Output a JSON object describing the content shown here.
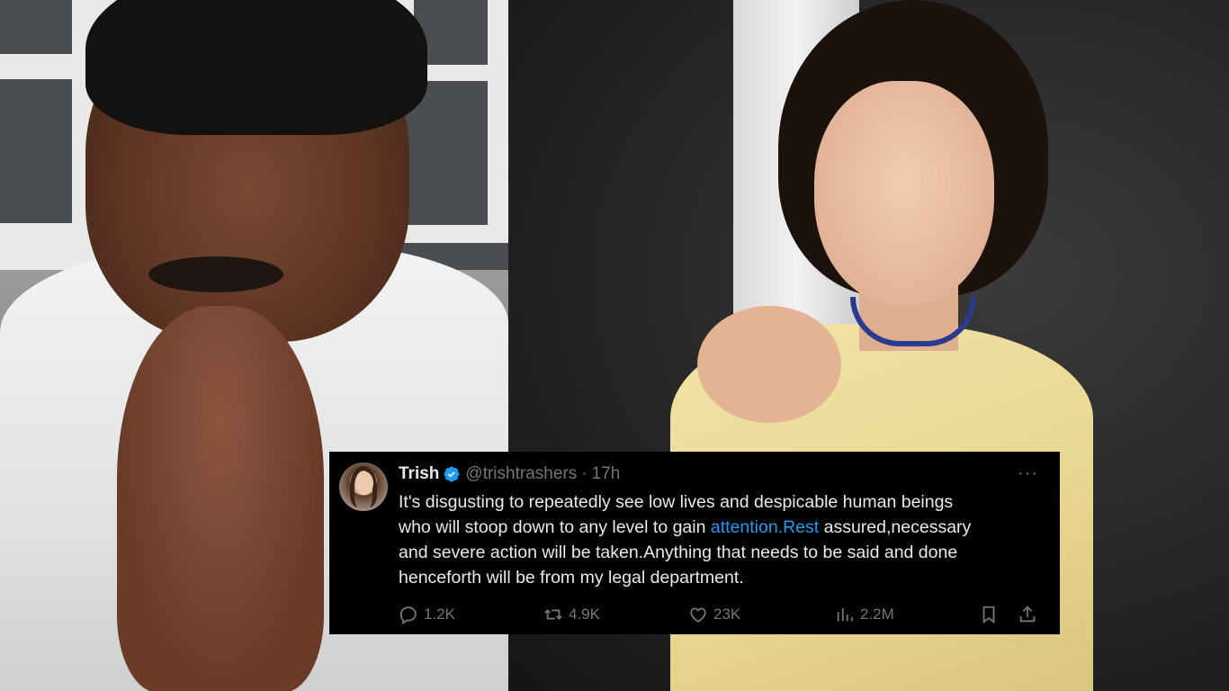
{
  "tweet": {
    "name": "Trish",
    "handle": "@trishtrashers",
    "separator": "·",
    "time": "17h",
    "more_label": "···",
    "text_lines": [
      "It's disgusting to repeatedly see low lives and despicable human beings",
      "who will stoop down to any level to gain",
      " assured,necessary",
      "and severe action will be taken.Anything that needs to be said and done",
      "henceforth will be from my legal department."
    ],
    "link_text": "attention.Rest",
    "stats": {
      "replies": "1.2K",
      "reposts": "4.9K",
      "likes": "23K",
      "views": "2.2M"
    }
  },
  "colors": {
    "link": "#1d9bf0",
    "verified": "#1d9bf0",
    "muted": "#71767b",
    "text": "#e7e9ea",
    "card_bg": "#000000"
  },
  "icons": [
    "verified-badge-icon",
    "more-icon",
    "reply-icon",
    "repost-icon",
    "like-icon",
    "views-icon",
    "bookmark-icon",
    "share-icon"
  ]
}
